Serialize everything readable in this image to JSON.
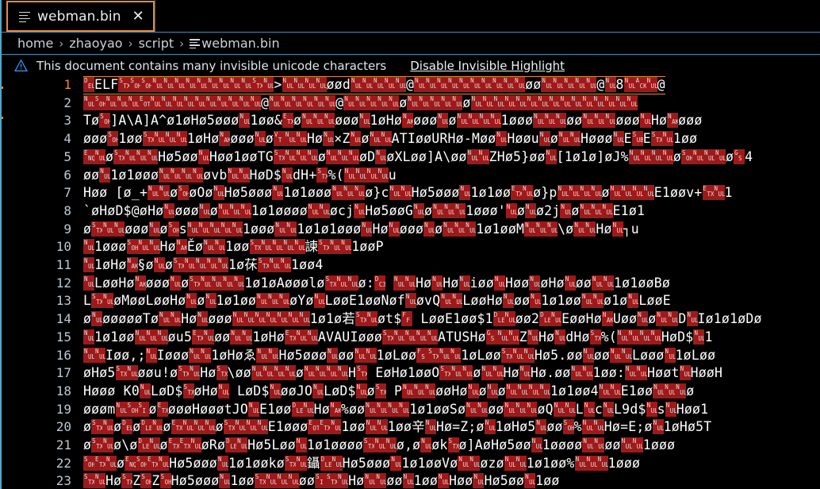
{
  "window": {
    "accent_orange": "#e8893b",
    "border_blue": "#4a8fb5",
    "invisible_char_bg": "#9e1a1a",
    "background": "#000000",
    "foreground": "#ffffff"
  },
  "tab_bar": {
    "tabs": [
      {
        "label": "webman.bin",
        "icon": "file-lines-icon",
        "close_label": "✕",
        "active": true
      }
    ]
  },
  "breadcrumb": {
    "separator": "›",
    "segments": [
      "home",
      "zhaoyao",
      "script"
    ],
    "file": "webman.bin",
    "file_icon": "file-lines-icon"
  },
  "banner": {
    "icon": "warning-triangle-icon",
    "message": "This document contains many invisible unicode characters",
    "action_label": "Disable Invisible Highlight"
  },
  "editor": {
    "active_line": 1,
    "first_visible_line": 1,
    "last_visible_line": 23,
    "overview_marks": [
      110,
      148
    ],
    "lines": [
      {
        "n": "1",
        "t": "c:DEL|w:ELF|c:STX|c:SOH|c:SOH|c:NUL|c:NUL|c:NUL|c:NUL|c:NUL|c:NUL|c:NUL|c:NUL|c:NUL|c:STX|c:NUL|w:>|c:NUL|c:NUL|c:NUL|c:NUL|w:øød|c:NUL|c:NUL|c:NUL|c:NUL|c:NUL|w:@|c:NUL|c:NUL|c:NUL|c:NUL|c:NUL|c:NUL|c:NUL|c:NUL|c:NUL|c:NUL|w:øø|c:NUL|c:NUL|c:NUL|c:NUL|c:NUL|w:@|c:NUL|w:8|c:NUL|c:ACK|c:NUL|w:@"
      },
      {
        "n": "2",
        "t": "c:NUL|c:SOH|c:NUL|c:NUL|c:NUL|c:EOT|c:NUL|c:NUL|c:NUL|c:NUL|c:NUL|c:NUL|c:NUL|c:NUL|c:NUL|c:NUL|w:@|c:NUL|c:NUL|c:NUL|c:NUL|c:NUL|c:NUL|w:@|c:NUL|c:NUL|c:NUL|c:NUL|c:NUL|w:ø|c:NUL|c:NUL|c:NUL|c:NUL|c:NUL|w:ø|c:NUL|c:NUL|c:NUL|c:NUL|c:NUL|c:NUL|c:NUL|c:NUL|c:NUL|c:NUL|c:NUL|c:NUL|c:NUL|c:NUL|c:NUL"
      },
      {
        "n": "3",
        "t": "w:Tø|c:SOH|w:]A\\A]A^ø1øHø5øøø|c:NUL|w:1øø&|c:ETX|w:ø|c:NUL|c:NUL|c:NUL|w:øøø|c:NUL|w:1øHø|c:NAK|w:øøø|c:NUL|w:ø|c:NUL|c:NUL|c:NUL|c:NUL|w:1øøø|c:NUL|c:NUL|c:NUL|w:øø|c:NUL|c:NUL|c:NUL|w:øøø|c:NUL|w:Hø|c:NAK|w:øøø"
      },
      {
        "n": "4",
        "t": "w:øøø|c:SOH|w:1øø|c:STX|c:NUL|c:NUL|c:NUL|w:1øHø|c:NAK|w:øøø|c:NUL|w:ø|c:VT|c:NUL|c:NUL|w:Hø|c:NUL|w:×Z|c:NUL|w:ø|c:NUL|c:NUL|w:ATIøøURHø-Møø|c:NUL|w:Høøu|c:NUL|w:ø|c:NUL|c:NUL|w:Høøø|c:NUL|w:E|c:SUB|w:E|c:STX|c:NUL|w:1øø"
      },
      {
        "n": "5",
        "t": "c:ENQ|c:NUL|w:ø|c:STX|c:NUL|c:NUL|c:NUL|w:Hø5øø|c:NUL|w:Høø1øøTG|c:STX|c:NUL|c:NUL|c:NUL|w:ø|c:NUL|c:NUL|c:NUL|w:øD|c:NUL|w:øXLøø]A\\øø|c:NUL|c:NUL|w:ZHø5}øø|c:NUL|w:[1ø1ø]øJ%|c:NUL|c:NUL|c:NUL|c:NUL|w:ø|c:SOH|c:NUL|c:NUL|c:NUL|w:ø|c:GS|w:4"
      },
      {
        "n": "6",
        "t": "w:øø|c:NUL|w:1ø1øøø|c:NUL|c:NUL|c:NUL|c:NUL|w:øvb|c:NUL|c:NUL|w:HøD$|c:NUL|w:dH+|c:STX|w:%(|c:NUL|c:NUL|c:NUL|c:NUL|w:u"
      },
      {
        "n": "7",
        "t": "w:Høø|w:  [ø_+|c:NUL|c:NUL|w:ø|c:SOH|w:øOø|c:NUL|w:Hø5øøø|c:NUL|w:1ø1øøø|c:NUL|c:NUL|c:NUL|w:ø}c|c:NUL|c:NUL|w:Hø5øøø|c:NUL|w:1ø1øø|c:ETX|c:NUL|w:ø}p|c:NUL|c:NUL|c:NUL|c:NUL|w:ø|c:NUL|c:NUL|c:NUL|c:NUL|w:E1øøv+|c:ETX|c:NUL|w:1"
      },
      {
        "n": "8",
        "t": "w:`øHøD$@øHø|c:NUL|w:øøø|c:NUL|w:ø|c:NUL|c:NUL|c:NUL|w:1ø1øøøø|c:NUL|c:NUL|w:øcj|c:NUL|w:Hø5øøG|c:NUL|w:ø|c:NUL|c:NUL|c:NUL|w:1øøø'|c:NUL|w:ø|c:NUL|w:ø2j|c:NUL|w:ø|c:NUL|c:NUL|c:NUL|w:E1ø1"
      },
      {
        "n": "9",
        "t": "w:ø|c:STX|c:NUL|c:NUL|w:øøø|c:NUL|w:ø|c:SOH|w:s|c:NUL|c:NUL|c:NUL|c:NUL|c:NUL|w:1øøø|c:NUL|c:NUL|w:1ø1ø1øøø|c:NUL|w:Hø|c:NUL|w:øøø|c:NUL|w:ø|c:NUL|c:NUL|c:NUL|w:1ø1øøM|c:NUL|c:NUL|c:NUL|w:\\ø|c:NUL|c:NUL|w:Hø|c:NUL|w:┐u"
      },
      {
        "n": "10",
        "t": "c:NUL|w:1øøø|c:SOH|c:NUL|c:NUL|w:Hø|c:NAK|w:Ěø|c:NUL|c:NUL|w:1øø|c:STX|c:NUL|c:NUL|c:NUL|c:NUL|w:諫|c:STX|c:NUL|c:NUL|w:1øøP"
      },
      {
        "n": "11",
        "t": "c:NUL|w:1øHø|c:NAK|w:§ø|c:NUL|w:ø|c:STX|c:NUL|c:NUL|c:NUL|c:NUL|w:1ø茠|c:STX|c:NUL|c:NUL|w:1øø4"
      },
      {
        "n": "12",
        "t": "c:NUL|w:LøøHø|c:NAK|w:øøø|c:NUL|w:ø|c:STX|c:NUL|c:NUL|c:NUL|c:NUL|w:1ø1øAøøølø|c:STX|c:NUL|c:NUL|w:ø:|c:DC3|w: |c:NUL|c:NUL|w:Hø|c:NUL|w:Hø|c:NUL|w:iøø|c:NUL|w:Høø|c:NUL|w:øHø|c:NUL|w:øø|c:NUL|c:NUL|w:1ø1øøBø"
      },
      {
        "n": "13",
        "t": "w:L|c:STX|c:NUL|w:øMøøLøøHø|c:NUL|w:ø|c:NUL|w:1ø1øø|c:NUL|c:NUL|c:NUL|w:øYø|c:NUL|w:LøøE1øøNøf|c:NUL|w:øvQ|c:NUL|c:NUL|w:LøøHø|c:NUL|w:øø|c:NUL|w:1ø1øø|c:NUL|c:NUL|w:ø1ø|c:NUL|w:LøøE"
      },
      {
        "n": "14",
        "t": "w:ø|c:NUL|w:øøøøøTø|c:NUL|c:NUL|w:Hø|c:NUL|w:øøø|c:NUL|c:NUL|c:NUL|c:NUL|c:NUL|c:NUL|c:NUL|w:1ø1ø若|c:STX|c:NUL|w:øt$|c:FF|w: LøøE1øø$1|c:DLE|c:NUL|w:øø2|c:DLE|c:NUL|w:EøøHø|c:NAK|w:Uøø|c:NUL|w:ø|c:NUL|c:NUL|w:D|c:NUL|w:Iø1ø1øDø"
      },
      {
        "n": "15",
        "t": "c:NUL|w:1ø1øø|c:NUL|c:NUL|c:NUL|w:øu5|c:ETX|c:NUL|w:øø|c:NUL|c:NUL|w:1øHø|c:ETX|c:NUL|c:NUL|w:AVAUIøøø|c:STX|c:NUL|c:NUL|c:NUL|c:NUL|w:ATUSHø|c:GS|c:NUL|c:NUL|w:Z|c:NUL|w:Hø|c:NUL|w:dHø|c:STX|w:%(|c:NUL|c:NUL|c:NUL|c:NUL|w:HøD$|c:NUL|w:1"
      },
      {
        "n": "16",
        "t": "c:NUL|c:NUL|w:Iøø,;|c:NUL|w:Iøøø|c:NUL|c:NUL|w:1øHøゑ|c:NUL|c:NUL|w:Hø5øøø|c:NUL|w:øø|c:NUL|c:NUL|w:1øLøø|c:FS|c:STX|c:NUL|c:NUL|w:1øLøø|c:STX|c:NUL|c:NUL|w:Hø5.øø|c:NUL|w:øø|c:NUL|c:NUL|w:Løøø|c:NUL|w:1øLøø"
      },
      {
        "n": "17",
        "t": "w:øHø5|c:STX|c:NUL|w:øøu!ø|$|c:STX|c:NUL|w:Hø|c:STX|w:\\øø|c:NUL|c:NUL|c:NUL|c:NUL|w:ø|c:NUL|c:NUL|c:NUL|c:NUL|w:H|c:STX|w: EøHø1øøO|c:STX|c:NUL|c:NUL|w:ø|c:NUL|c:NUL|w:Hø|c:NUL|w:Hø.øø|c:NUL|c:NUL|w:1øø:|c:NUL|c:NUL|w:Høøt|c:NUL|w:HøøH"
      },
      {
        "n": "18",
        "t": "w:Høøø|w:    K0|c:NUL|w:LøD$|c:STX|w:øHø|$|c:NUL|w: LøD$|c:NUL|w:øøJO|c:NUL|w:LøD$|c:NUL|w:ø|c:STX|w: P|c:NUL|c:NUL|c:NUL|w:øøHø|c:NUL|w:ø|c:NUL|w:ø|c:NUL|c:NUL|c:NUL|c:NUL|w:1ø1øø4|c:NUL|c:NUL|w:E1øø|c:NUL|c:NUL|c:NUL|w:ø"
      },
      {
        "n": "19",
        "t": "w:øøøm|c:NUL|c:SOH|c:SI|w:ø|c:ETX|w:øøøHøøøtJO|c:NUL|w:E1øø|c:DLE|c:NUL|w:Hø|c:NAK|w:%øø|c:NUL|c:NUL|c:NUL|c:NUL|w:1ø1øøSø|c:NUL|c:NUL|w:øø|c:NUL|c:NUL|c:NUL|w:øQ|c:NUL|c:NUL|w:L|c:NUL|w:c|c:NUL|w:L9d$|c:NUL|w:s|c:NUL|w:Høø1"
      },
      {
        "n": "20",
        "t": "w:ø|c:STX|c:NUL|w:ø|c:DEL|w:ø|c:DLE|c:NUL|w:ø|c:ETX|c:NUL|c:NUL|c:NUL|w:ø|c:STX|c:NUL|c:NUL|c:NUL|w:E1øøø|c:EOT|c:ETX|c:NUL|w:1øø|c:NUL|c:NUL|w:1øø辛|c:NUL|w:Hø=Z;ø|c:NUL|w:1øHø5|c:NUL|w:øø|c:SOH|w:%|c:NUL|c:NUL|w:Hø=E;ø|c:NUL|w:1øHø5T"
      },
      {
        "n": "21",
        "t": "w:ø|c:STX|c:NUL|w:ø\\ø|c:DLE|c:NUL|w:ø|c:ETX|c:ETX|c:NUL|w:øRø|c:DLE|c:NUL|w:Hø5Løø|c:NUL|w:1ø1øøøø|c:STX|c:NUL|c:NUL|w:ø,ø|c:NUL|w:øk|c:STX|w:ø]AøHø5øø|c:NUL|w:1øøøø|c:NUL|c:NUL|w:øø|c:NUL|c:NUL|w:1øøø"
      },
      {
        "n": "22",
        "t": "c:SOH|c:ETX|c:NUL|w:ø|c:ENQ|c:SOH|c:ETX|c:NUL|w:Hø5øøø|c:NUL|w:1ø1øøkø|c:STX|c:NUL|w:鑷|c:DLE|c:NUL|w:Hø5øøø|c:NUL|w:1ø1øøVø|c:NUL|c:NUL|w:øzø|c:NUL|c:NUL|w:1ø1øø%|c:NUL|c:NUL|c:NUL|w:1øøø"
      },
      {
        "n": "23",
        "t": "c:STX|c:NUL|w:Hø|c:STX|w:Z|c:SOH|w:Z|c:SOH|w:Hø5øøø|c:NUL|w:1øø|c:STX|c:NUL|c:NUL|c:NUL|w:øø|c:SI|c:STX|c:NUL|w:Hø|c:NUL|c:NUL|w:øø|c:NUL|w:1øø|c:NUL|w:Høø|c:NUL|w:Hø5øø|c:NUL|w:1øø"
      }
    ]
  }
}
